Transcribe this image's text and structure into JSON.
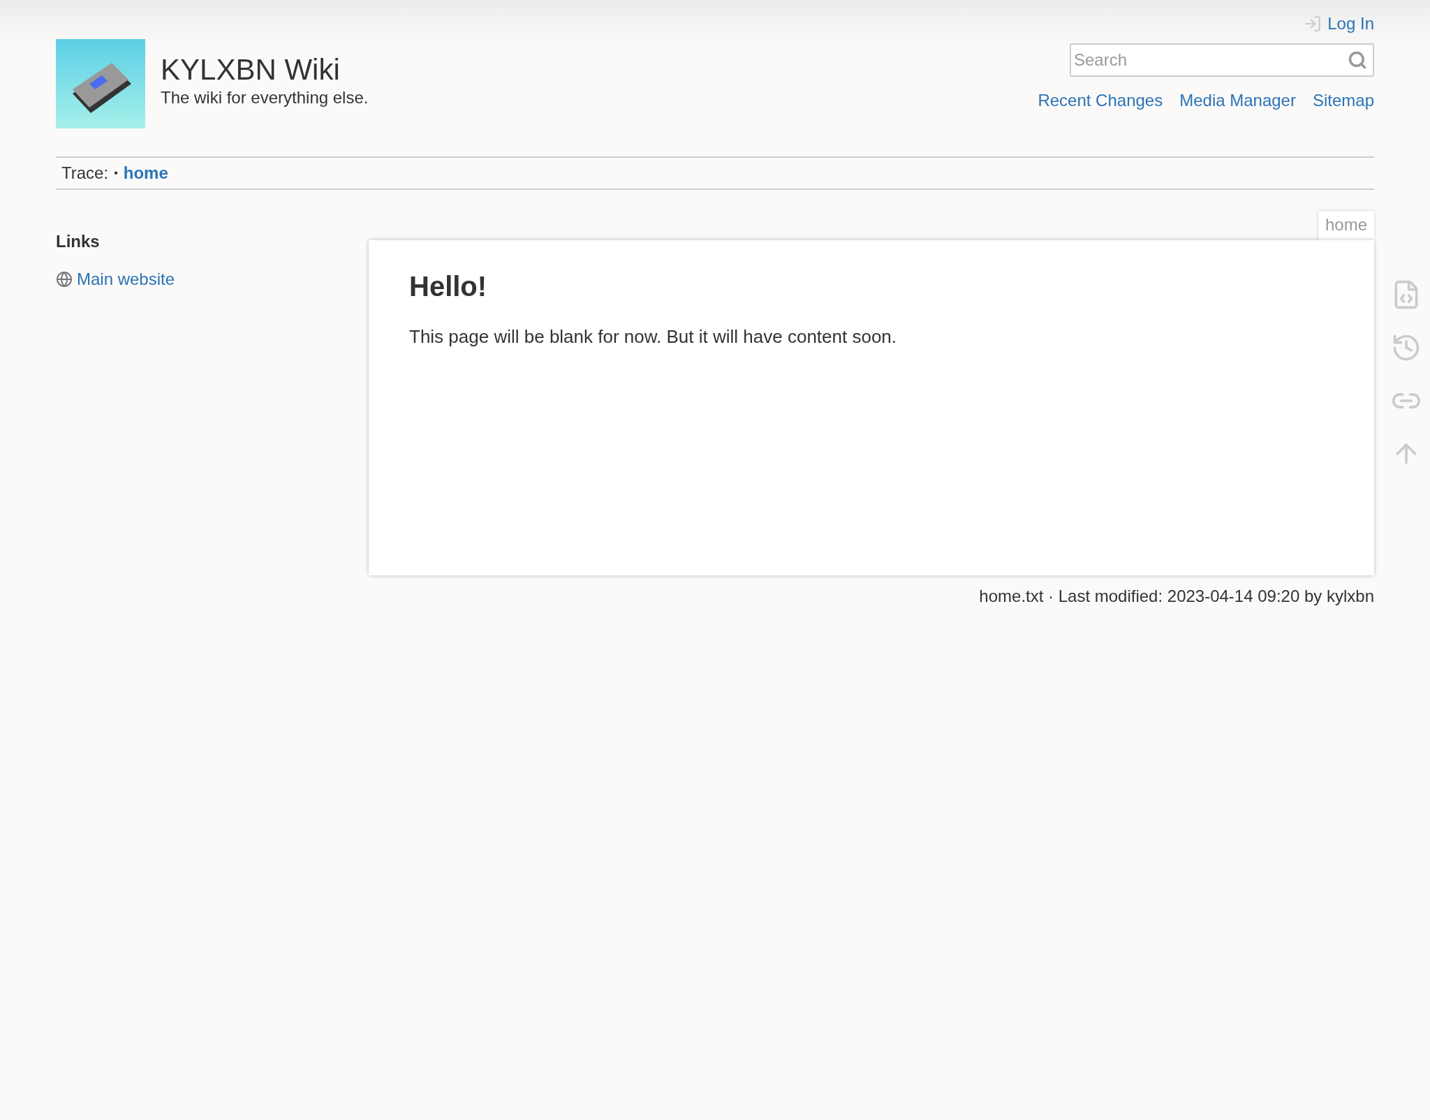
{
  "header": {
    "title": "KYLXBN Wiki",
    "tagline": "The wiki for everything else.",
    "login": "Log In",
    "search": {
      "placeholder": "Search"
    },
    "nav": [
      "Recent Changes",
      "Media Manager",
      "Sitemap"
    ]
  },
  "breadcrumbs": {
    "label": "Trace:",
    "separator": "•",
    "items": [
      "home"
    ]
  },
  "sidebar": {
    "heading": "Links",
    "links": [
      "Main website"
    ]
  },
  "page": {
    "tab": "home",
    "heading": "Hello!",
    "body": "This page will be blank for now. But it will have content soon.",
    "footer": "home.txt · Last modified: 2023-04-14 09:20 by kylxbn"
  },
  "page_tools": [
    {
      "kind": "source"
    },
    {
      "kind": "revisions"
    },
    {
      "kind": "backlinks"
    },
    {
      "kind": "top"
    }
  ]
}
